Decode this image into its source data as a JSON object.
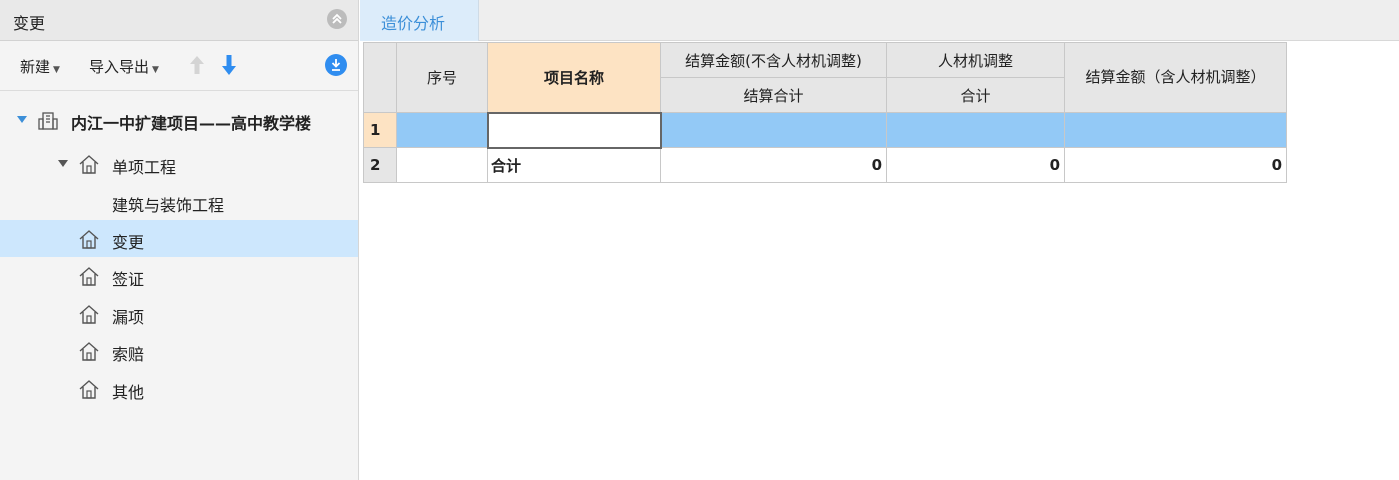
{
  "left_panel": {
    "title": "变更",
    "toolbar": {
      "new_label": "新建",
      "import_export_label": "导入导出"
    },
    "tree": {
      "root": "内江一中扩建项目——高中教学楼",
      "group": "单项工程",
      "group_child": "建筑与装饰工程",
      "items": [
        "变更",
        "签证",
        "漏项",
        "索赔",
        "其他"
      ],
      "selected_item": "变更"
    }
  },
  "tabs": [
    {
      "label": "造价分析",
      "active": true
    }
  ],
  "table": {
    "headers": {
      "seq": "序号",
      "name": "项目名称",
      "settle_excl": "结算金额(不含人材机调整)",
      "settle_excl_sub": "结算合计",
      "adjust": "人材机调整",
      "adjust_sub": "合计",
      "settle_incl": "结算金额（含人材机调整）"
    },
    "rows": [
      {
        "row_no": "1",
        "seq": "",
        "name": "",
        "settle_excl": "",
        "adjust": "",
        "settle_incl": ""
      },
      {
        "row_no": "2",
        "seq": "",
        "name": "合计",
        "settle_excl": "0",
        "adjust": "0",
        "settle_incl": "0"
      }
    ]
  },
  "colors": {
    "accent": "#2f8df0",
    "selected_row": "#93c9f6",
    "tree_selected": "#cde7fd",
    "name_header": "#fde3c3"
  }
}
